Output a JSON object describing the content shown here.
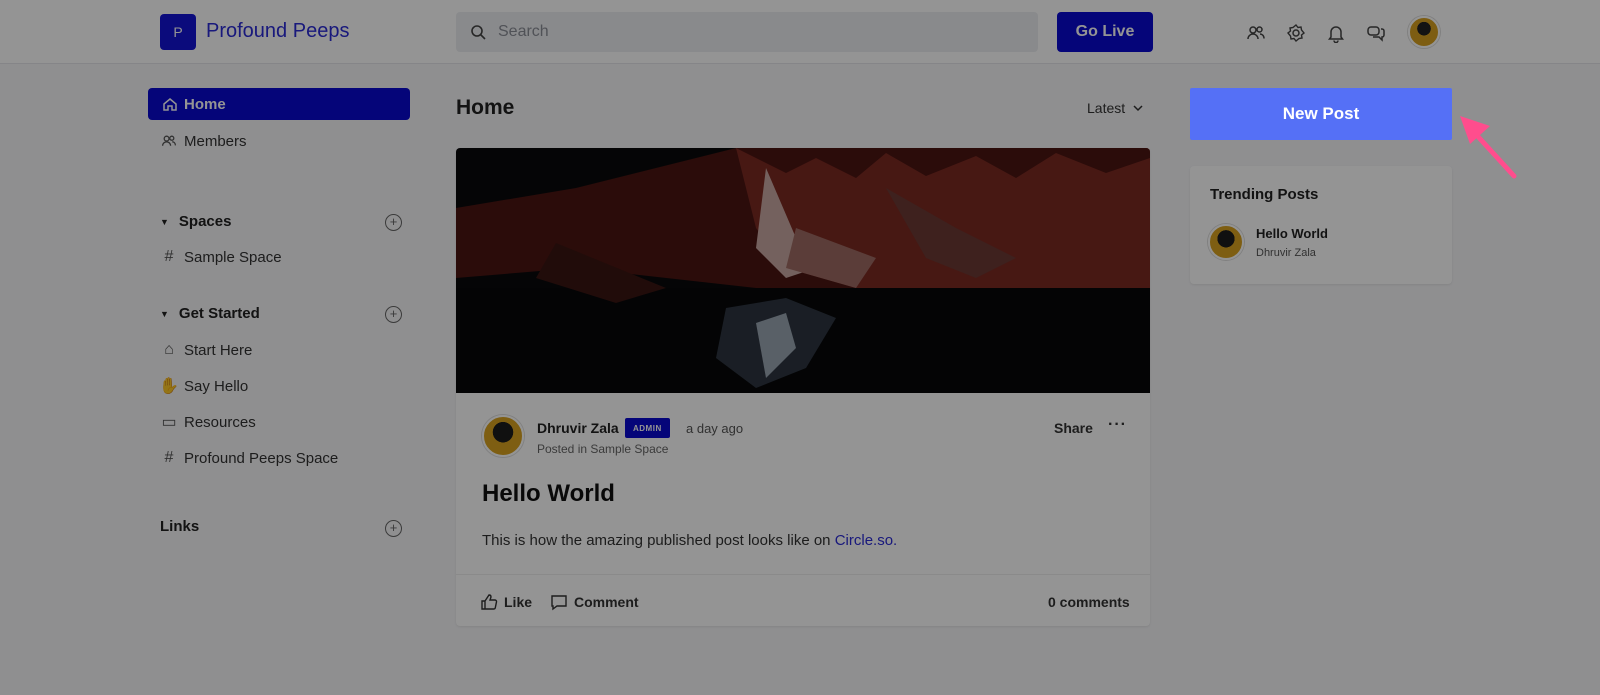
{
  "header": {
    "logo_letter": "P",
    "brand": "Profound Peeps",
    "search_placeholder": "Search",
    "go_live": "Go Live"
  },
  "sidebar": {
    "home": "Home",
    "members": "Members",
    "spaces_title": "Spaces",
    "spaces_items": [
      "Sample Space"
    ],
    "get_started_title": "Get Started",
    "get_started_items": [
      "Start Here",
      "Say Hello",
      "Resources",
      "Profound Peeps Space"
    ],
    "links_title": "Links"
  },
  "main": {
    "title": "Home",
    "sort": "Latest",
    "post": {
      "author": "Dhruvir Zala",
      "badge": "ADMIN",
      "time": "a day ago",
      "posted_in": "Posted in Sample Space",
      "share": "Share",
      "more": "···",
      "title": "Hello World",
      "body": "This is how the amazing published post looks like on",
      "link": "Circle.so.",
      "like": "Like",
      "comment": "Comment",
      "comments_count": "0 comments"
    }
  },
  "right": {
    "new_post": "New Post",
    "trending_title": "Trending Posts",
    "trending_post": "Hello World",
    "trending_author": "Dhruvir Zala"
  },
  "colors": {
    "brand": "#0a0ad0",
    "new_post": "#5570f6",
    "arrow": "#ff4d8d"
  }
}
